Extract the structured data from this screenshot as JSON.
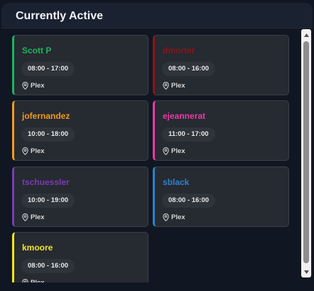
{
  "panel": {
    "title": "Currently Active"
  },
  "cards": [
    {
      "name": "Scott P",
      "hours": "08:00 - 17:00",
      "location": "Plex",
      "color": "#1db55c"
    },
    {
      "name": "dmorter",
      "hours": "08:00 - 16:00",
      "location": "Plex",
      "color": "#8b1515"
    },
    {
      "name": "jofernandez",
      "hours": "10:00 - 18:00",
      "location": "Plex",
      "color": "#f39a1e"
    },
    {
      "name": "ejeannerat",
      "hours": "11:00 - 17:00",
      "location": "Plex",
      "color": "#e83aa8"
    },
    {
      "name": "tschuessler",
      "hours": "10:00 - 19:00",
      "location": "Plex",
      "color": "#7a3cb3"
    },
    {
      "name": "sblack",
      "hours": "08:00 - 16:00",
      "location": "Plex",
      "color": "#2f80d0"
    },
    {
      "name": "kmoore",
      "hours": "08:00 - 16:00",
      "location": "Plex",
      "color": "#f3e61c"
    }
  ],
  "icons": {
    "location": "map-pin-icon",
    "scroll_up": "chevron-up-icon",
    "scroll_down": "chevron-down-icon"
  }
}
